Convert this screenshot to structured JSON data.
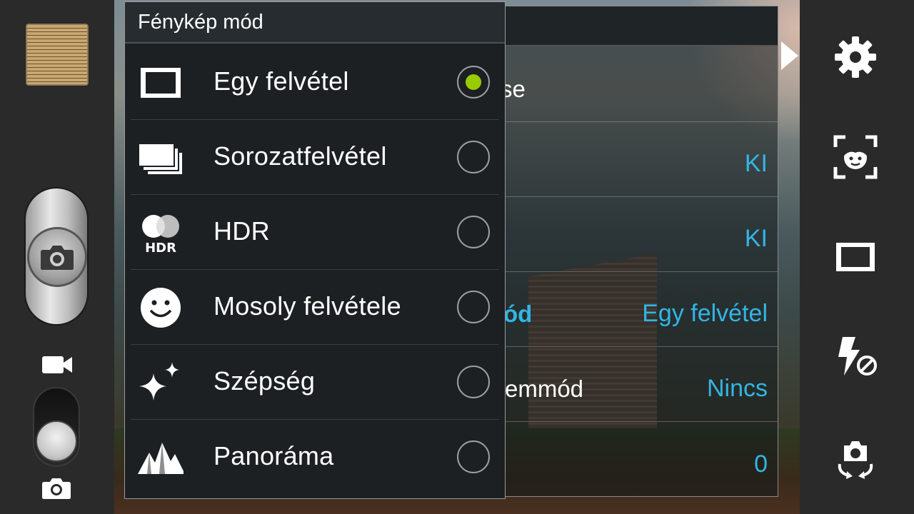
{
  "popup": {
    "title": "Fénykép mód",
    "options": [
      {
        "label": "Egy felvétel",
        "icon": "single-shot-icon",
        "selected": true
      },
      {
        "label": "Sorozatfelvétel",
        "icon": "burst-shot-icon",
        "selected": false
      },
      {
        "label": "HDR",
        "icon": "hdr-icon",
        "selected": false
      },
      {
        "label": "Mosoly felvétele",
        "icon": "smile-icon",
        "selected": false
      },
      {
        "label": "Szépség",
        "icon": "sparkle-icon",
        "selected": false
      },
      {
        "label": "Panoráma",
        "icon": "mountain-icon",
        "selected": false
      }
    ],
    "accent_color": "#99cc00"
  },
  "settings_panel": {
    "rows": [
      {
        "label": "se",
        "value": ""
      },
      {
        "label": "",
        "value": "KI"
      },
      {
        "label": "",
        "value": "KI"
      },
      {
        "label": "ód",
        "value": "Egy felvétel"
      },
      {
        "label": "emmód",
        "value": "Nincs"
      },
      {
        "label": "",
        "value": "0"
      }
    ],
    "value_color": "#33b5e5"
  },
  "right_bar": {
    "icons": [
      "gear-icon",
      "face-detect-icon",
      "shooting-mode-icon",
      "flash-off-icon",
      "switch-camera-icon"
    ]
  },
  "left_bar": {
    "icons": [
      "gallery-thumbnail",
      "camera-icon",
      "video-icon",
      "photo-mode-icon"
    ]
  }
}
